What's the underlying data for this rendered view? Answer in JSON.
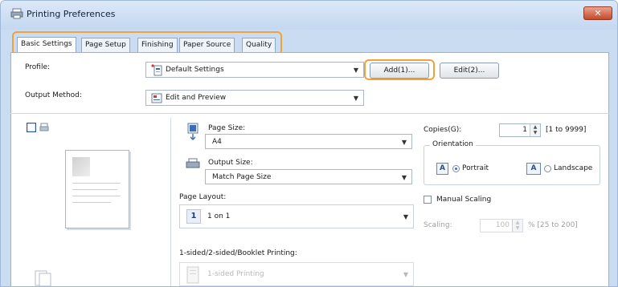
{
  "window": {
    "title": "Printing Preferences",
    "close_glyph": "✕"
  },
  "tabs": [
    {
      "label": "Basic Settings",
      "active": true
    },
    {
      "label": "Page Setup",
      "active": false
    },
    {
      "label": "Finishing",
      "active": false
    },
    {
      "label": "Paper Source",
      "active": false
    },
    {
      "label": "Quality",
      "active": false
    }
  ],
  "profile": {
    "label": "Profile:",
    "value": "Default Settings",
    "add_label": "Add(1)...",
    "edit_label": "Edit(2)..."
  },
  "output_method": {
    "label": "Output Method:",
    "value": "Edit and Preview"
  },
  "page_size": {
    "label": "Page Size:",
    "value": "A4"
  },
  "output_size": {
    "label": "Output Size:",
    "value": "Match Page Size"
  },
  "page_layout": {
    "label": "Page Layout:",
    "value": "1 on 1",
    "icon_text": "1"
  },
  "printing_mode": {
    "label": "1-sided/2-sided/Booklet Printing:",
    "value": "1-sided Printing"
  },
  "copies": {
    "label": "Copies(G):",
    "value": "1",
    "range": "[1 to 9999]"
  },
  "orientation": {
    "title": "Orientation",
    "portrait": "Portrait",
    "landscape": "Landscape",
    "selected": "Portrait",
    "icon_text": "A"
  },
  "manual_scaling": {
    "label": "Manual Scaling",
    "checked": false
  },
  "scaling": {
    "label": "Scaling:",
    "value": "100",
    "range": "% [25 to 200]"
  },
  "colors": {
    "highlight": "#f0a23a",
    "close": "#c7482a",
    "accent": "#2a6fd1"
  },
  "icons": [
    "printer-icon",
    "close-icon",
    "profile-icon",
    "output-method-icon",
    "page-size-icon",
    "output-size-icon",
    "page-layout-icon",
    "preview-icon"
  ]
}
